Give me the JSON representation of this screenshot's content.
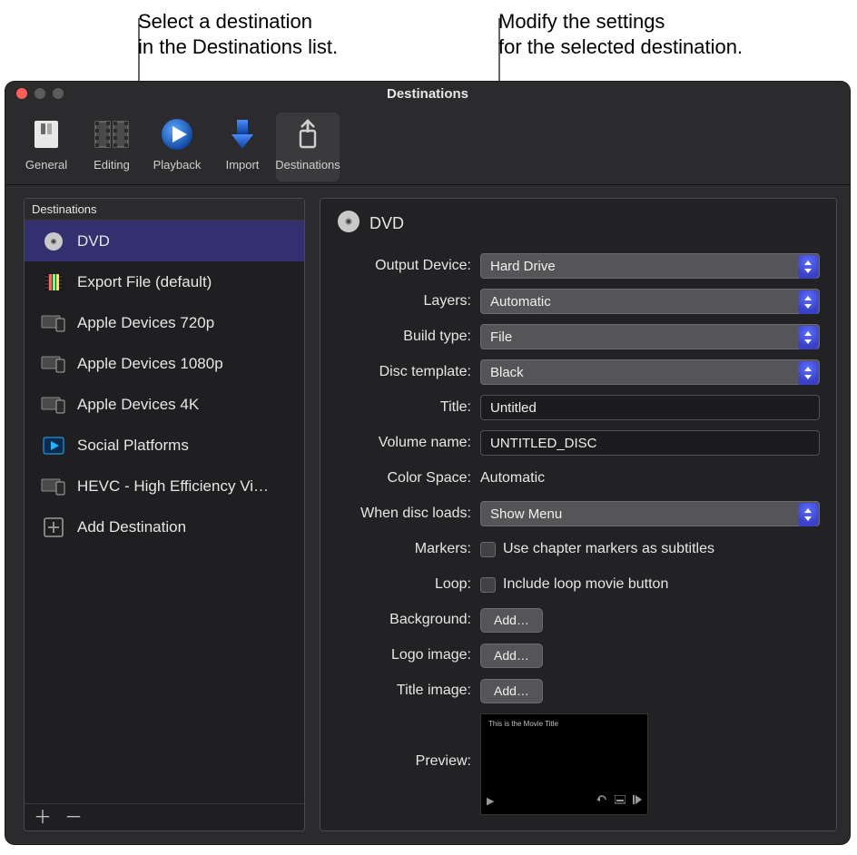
{
  "annotations": {
    "left_line1": "Select a destination",
    "left_line2": "in the Destinations list.",
    "right_line1": "Modify the settings",
    "right_line2": "for the selected destination."
  },
  "window": {
    "title": "Destinations",
    "toolbar": [
      {
        "id": "general",
        "label": "General"
      },
      {
        "id": "editing",
        "label": "Editing"
      },
      {
        "id": "playback",
        "label": "Playback"
      },
      {
        "id": "import",
        "label": "Import"
      },
      {
        "id": "destinations",
        "label": "Destinations"
      }
    ],
    "toolbar_active": "destinations"
  },
  "sidebar": {
    "header": "Destinations",
    "items": [
      {
        "id": "dvd",
        "label": "DVD",
        "icon": "disc",
        "selected": true
      },
      {
        "id": "export-file",
        "label": "Export File (default)",
        "icon": "film"
      },
      {
        "id": "ad-720",
        "label": "Apple Devices 720p",
        "icon": "devices"
      },
      {
        "id": "ad-1080",
        "label": "Apple Devices 1080p",
        "icon": "devices"
      },
      {
        "id": "ad-4k",
        "label": "Apple Devices 4K",
        "icon": "devices"
      },
      {
        "id": "social",
        "label": "Social Platforms",
        "icon": "play"
      },
      {
        "id": "hevc",
        "label": "HEVC - High Efficiency Vi…",
        "icon": "devices"
      },
      {
        "id": "add",
        "label": "Add Destination",
        "icon": "plus"
      }
    ]
  },
  "detail": {
    "title": "DVD",
    "fields": {
      "output_device": {
        "label": "Output Device:",
        "value": "Hard Drive"
      },
      "layers": {
        "label": "Layers:",
        "value": "Automatic"
      },
      "build_type": {
        "label": "Build type:",
        "value": "File"
      },
      "disc_template": {
        "label": "Disc template:",
        "value": "Black"
      },
      "title": {
        "label": "Title:",
        "value": "Untitled"
      },
      "volume_name": {
        "label": "Volume name:",
        "value": "UNTITLED_DISC"
      },
      "color_space": {
        "label": "Color Space:",
        "value": "Automatic"
      },
      "when_disc_loads": {
        "label": "When disc loads:",
        "value": "Show Menu"
      },
      "markers": {
        "label": "Markers:",
        "text": "Use chapter markers as subtitles"
      },
      "loop": {
        "label": "Loop:",
        "text": "Include loop movie button"
      },
      "background": {
        "label": "Background:",
        "button": "Add…"
      },
      "logo_image": {
        "label": "Logo image:",
        "button": "Add…"
      },
      "title_image": {
        "label": "Title image:",
        "button": "Add…"
      },
      "preview": {
        "label": "Preview:",
        "caption": "This is the Movie Title"
      }
    }
  }
}
